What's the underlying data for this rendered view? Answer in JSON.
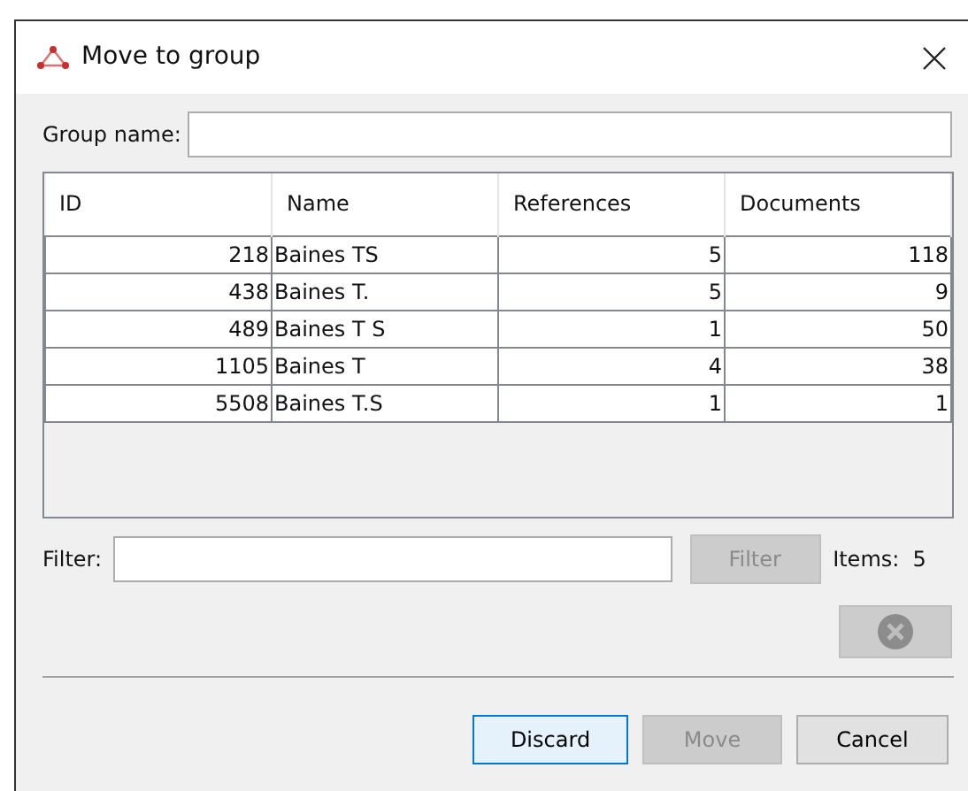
{
  "window": {
    "title": "Move to group"
  },
  "group_name": {
    "label": "Group name:"
  },
  "table": {
    "columns": [
      "ID",
      "Name",
      "References",
      "Documents"
    ],
    "rows": [
      [
        "218",
        "Baines TS",
        "5",
        "118"
      ],
      [
        "438",
        "Baines T.",
        "5",
        "9"
      ],
      [
        "489",
        "Baines T S",
        "1",
        "50"
      ],
      [
        "1105",
        "Baines T",
        "4",
        "38"
      ],
      [
        "5508",
        "Baines T.S",
        "1",
        "1"
      ]
    ]
  },
  "filter": {
    "label": "Filter:",
    "button": {
      "label": "Filter",
      "disabled": true
    },
    "items": "Items:  5"
  },
  "clear_button": {
    "disabled": true
  },
  "buttons": [
    {
      "label": "Discard",
      "disabled": false,
      "focused": true
    },
    {
      "label": "Move",
      "disabled": true,
      "focused": false
    },
    {
      "label": "Cancel",
      "disabled": false,
      "focused": false
    }
  ]
}
